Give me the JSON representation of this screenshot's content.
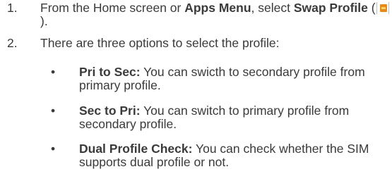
{
  "steps": [
    {
      "number": "1.",
      "text_pre": "From the Home screen or ",
      "bold1": "Apps Menu",
      "text_mid": ", select ",
      "bold2": "Swap Profile",
      "text_open": " (",
      "icon": "sim-card-icon",
      "text_close": " )."
    },
    {
      "number": "2.",
      "text": "There are three options to select the profile:"
    }
  ],
  "options": [
    {
      "bullet": "•",
      "title": "Pri to Sec:",
      "desc": " You can swicth to secondary profile from primary profile."
    },
    {
      "bullet": "•",
      "title": "Sec to Pri:",
      "desc": " You can switch to primary profile from secondary profile."
    },
    {
      "bullet": "•",
      "title": "Dual Profile Check:",
      "desc": " You can check whether the SIM supports dual profile or not."
    }
  ],
  "colors": {
    "text": "#3a3a3a",
    "icon_chip": "#e88a1a"
  }
}
